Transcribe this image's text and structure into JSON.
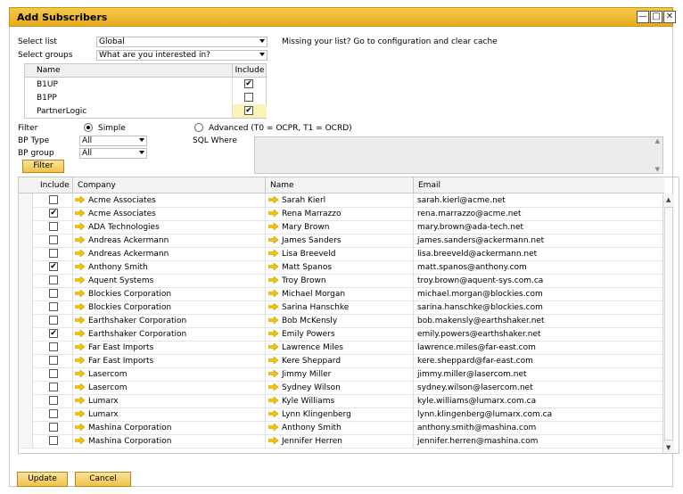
{
  "window": {
    "title": "Add Subscribers",
    "minimize_glyph": "—",
    "maximize_glyph": "□",
    "close_glyph": "✕"
  },
  "form": {
    "select_list_label": "Select list",
    "select_list_value": "Global",
    "select_groups_label": "Select groups",
    "select_groups_value": "What are you interested in?",
    "missing_note": "Missing your list? Go to configuration and clear cache"
  },
  "groups": {
    "header_name": "Name",
    "header_include": "Include",
    "rows": [
      {
        "name": "B1UP",
        "checked": true
      },
      {
        "name": "B1PP",
        "checked": false
      },
      {
        "name": "PartnerLogic",
        "checked": true
      }
    ]
  },
  "filter": {
    "label": "Filter",
    "simple_label": "Simple",
    "advanced_label": "Advanced (T0 = OCPR, T1 = OCRD)",
    "selected": "simple",
    "bp_type_label": "BP Type",
    "bp_type_value": "All",
    "bp_group_label": "BP group",
    "bp_group_value": "All",
    "sql_where_label": "SQL Where",
    "filter_button": "Filter"
  },
  "table": {
    "columns": [
      "Include",
      "Company",
      "Name",
      "Email"
    ],
    "rows": [
      {
        "include": false,
        "company": "Acme Associates",
        "name": "Sarah Kierl",
        "email": "sarah.kierl@acme.net"
      },
      {
        "include": true,
        "company": "Acme Associates",
        "name": "Rena Marrazzo",
        "email": "rena.marrazzo@acme.net"
      },
      {
        "include": false,
        "company": "ADA Technologies",
        "name": "Mary Brown",
        "email": "mary.brown@ada-tech.net"
      },
      {
        "include": false,
        "company": "Andreas Ackermann",
        "name": "James Sanders",
        "email": "james.sanders@ackermann.net"
      },
      {
        "include": false,
        "company": "Andreas Ackermann",
        "name": "Lisa Breeveld",
        "email": "lisa.breeveld@ackermann.net"
      },
      {
        "include": true,
        "company": "Anthony Smith",
        "name": "Matt Spanos",
        "email": "matt.spanos@anthony.com"
      },
      {
        "include": false,
        "company": "Aquent Systems",
        "name": "Troy Brown",
        "email": "troy.brown@aquent-sys.com.ca"
      },
      {
        "include": false,
        "company": "Blockies Corporation",
        "name": "Michael Morgan",
        "email": "michael.morgan@blockies.com"
      },
      {
        "include": false,
        "company": "Blockies Corporation",
        "name": "Sarina Hanschke",
        "email": "sarina.hanschke@blockies.com"
      },
      {
        "include": false,
        "company": "Earthshaker Corporation",
        "name": "Bob McKensly",
        "email": "bob.makensly@earthshaker.net"
      },
      {
        "include": true,
        "company": "Earthshaker Corporation",
        "name": "Emily Powers",
        "email": "emily.powers@earthshaker.net"
      },
      {
        "include": false,
        "company": "Far East Imports",
        "name": "Lawrence Miles",
        "email": "lawrence.miles@far-east.com"
      },
      {
        "include": false,
        "company": "Far East Imports",
        "name": "Kere Sheppard",
        "email": "kere.sheppard@far-east.com"
      },
      {
        "include": false,
        "company": "Lasercom",
        "name": "Jimmy Miller",
        "email": "jimmy.miller@lasercom.net"
      },
      {
        "include": false,
        "company": "Lasercom",
        "name": "Sydney Wilson",
        "email": "sydney.wilson@lasercom.net"
      },
      {
        "include": false,
        "company": "Lumarx",
        "name": "Kyle Williams",
        "email": "kyle.williams@lumarx.com.ca"
      },
      {
        "include": false,
        "company": "Lumarx",
        "name": "Lynn Klingenberg",
        "email": "lynn.klingenberg@lumarx.com.ca"
      },
      {
        "include": false,
        "company": "Mashina Corporation",
        "name": "Anthony Smith",
        "email": "anthony.smith@mashina.com"
      },
      {
        "include": false,
        "company": "Mashina Corporation",
        "name": "Jennifer Herren",
        "email": "jennifer.herren@mashina.com"
      }
    ]
  },
  "footer": {
    "update_label": "Update",
    "cancel_label": "Cancel"
  },
  "colors": {
    "accent": "#f0c24a",
    "link_arrow": "#f5c400",
    "selected_cell": "#fbf3b5"
  },
  "icons": {
    "link_arrow": "link-arrow-icon",
    "check": "✔"
  }
}
